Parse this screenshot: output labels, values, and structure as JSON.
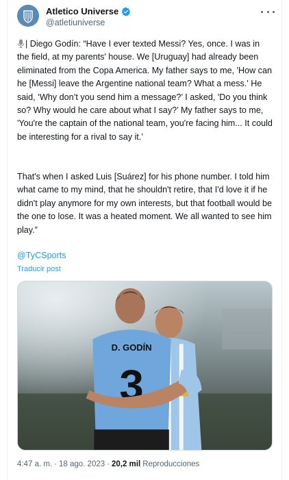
{
  "account": {
    "display_name": "Atletico Universe",
    "handle": "@atletiuniverse",
    "avatar_icon": "club-crest-icon",
    "verified_icon": "verified-badge-icon",
    "verified_color": "#1d9bf0"
  },
  "tweet": {
    "paragraph1": "| Diego Godín: “Have I ever texted Messi? Yes, once. I was in the field, at my parents' house. We [Uruguay] had already been eliminated from the Copa America. My father says to me, 'How can he [Messi] leave the Argentine national team? What a mess.' He said, ‘Why don’t you send him a message?’ I asked, 'Do you think so? Why would he care about what I say?’ My father says to me, 'You're the captain of the national team, you're facing him... It could be interesting for a rival to say it.’",
    "paragraph2": "That's when I asked Luis [Suárez] for his phone number. I told him what came to my mind, that he shouldn't retire, that I'd love it if he didn't play anymore for my own interests, but that football would be the one to lose. It was a heated moment. We all wanted to see him play.”",
    "mention": "@TyCSports",
    "translate_label": "Traducir post",
    "media_jersey_name": "D. GODÍN",
    "media_jersey_number": "3"
  },
  "meta": {
    "time": "4:47 a. m.",
    "separator": "·",
    "date": "18 ago. 2023",
    "views_count": "20,2 mil",
    "views_label": "Reproducciones"
  },
  "colors": {
    "link": "#1d9bf0",
    "secondary_text": "#536471",
    "uruguay_blue": "#6fa6dc"
  }
}
